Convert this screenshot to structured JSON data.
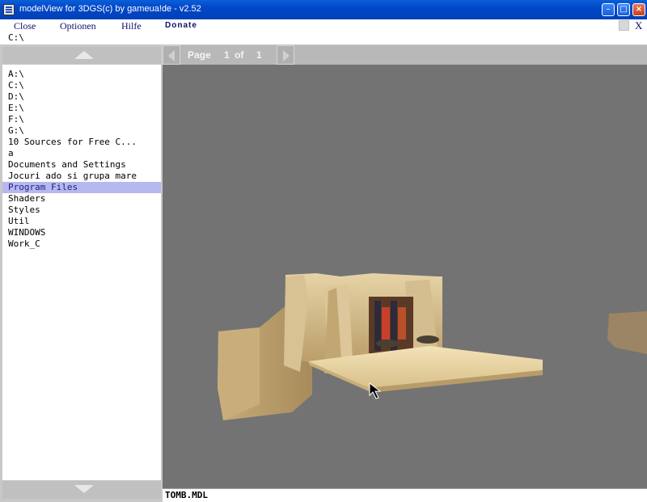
{
  "window": {
    "title": "modelView for 3DGS(c) by gameua!de - v2.52"
  },
  "menu": {
    "close": "Close",
    "options": "Optionen",
    "help": "Hilfe",
    "donate": "Donate",
    "close_x": "X"
  },
  "path": "C:\\",
  "file_list": [
    "A:\\",
    "C:\\",
    "D:\\",
    "E:\\",
    "F:\\",
    "G:\\",
    "10 Sources for Free C...",
    "a",
    "Documents and Settings",
    "Jocuri ado si grupa mare",
    "Program Files",
    "Shaders",
    "Styles",
    "Util",
    "WINDOWS",
    "Work_C"
  ],
  "selected_item": "Program Files",
  "pager": {
    "label": "Page",
    "current": "1",
    "of": "of",
    "total": "1"
  },
  "status": {
    "filename": "TOMB.MDL"
  },
  "colors": {
    "viewport_bg": "#737373",
    "selection": "#b8b8f0",
    "titlebar": "#0047c8"
  }
}
